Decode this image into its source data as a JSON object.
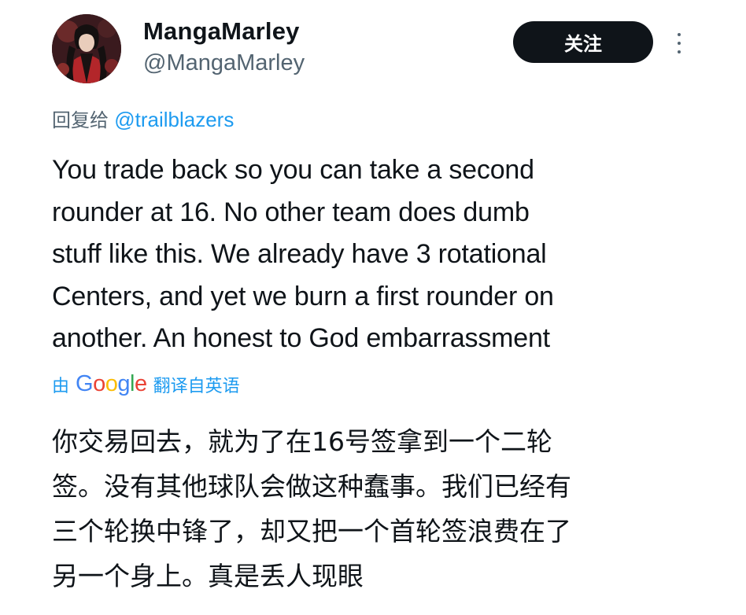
{
  "author": {
    "name": "MangaMarley",
    "handle": "@MangaMarley",
    "avatar_icon": "anime-character-avatar"
  },
  "follow_button": {
    "label": "关注"
  },
  "more_menu": {
    "icon": "more-vertical-icon"
  },
  "reply": {
    "prefix": "回复给",
    "target": "@trailblazers"
  },
  "tweet": {
    "lines": [
      "You trade back so you can take a second",
      "rounder at 16. No other team does dumb",
      "stuff like this. We already have 3 rotational",
      "Centers, and yet we burn a first rounder on",
      "another. An honest to God embarrassment"
    ]
  },
  "translation": {
    "by_prefix": "由",
    "provider": "Google",
    "suffix": "翻译自英语",
    "lines": [
      "你交易回去，就为了在16号签拿到一个二轮",
      "签。没有其他球队会做这种蠢事。我们已经有",
      "三个轮换中锋了，却又把一个首轮签浪费在了",
      "另一个身上。真是丢人现眼"
    ]
  },
  "colors": {
    "link": "#1d9bf0",
    "secondary_text": "#536471",
    "primary_text": "#0f1419",
    "button_bg": "#0f1419"
  }
}
